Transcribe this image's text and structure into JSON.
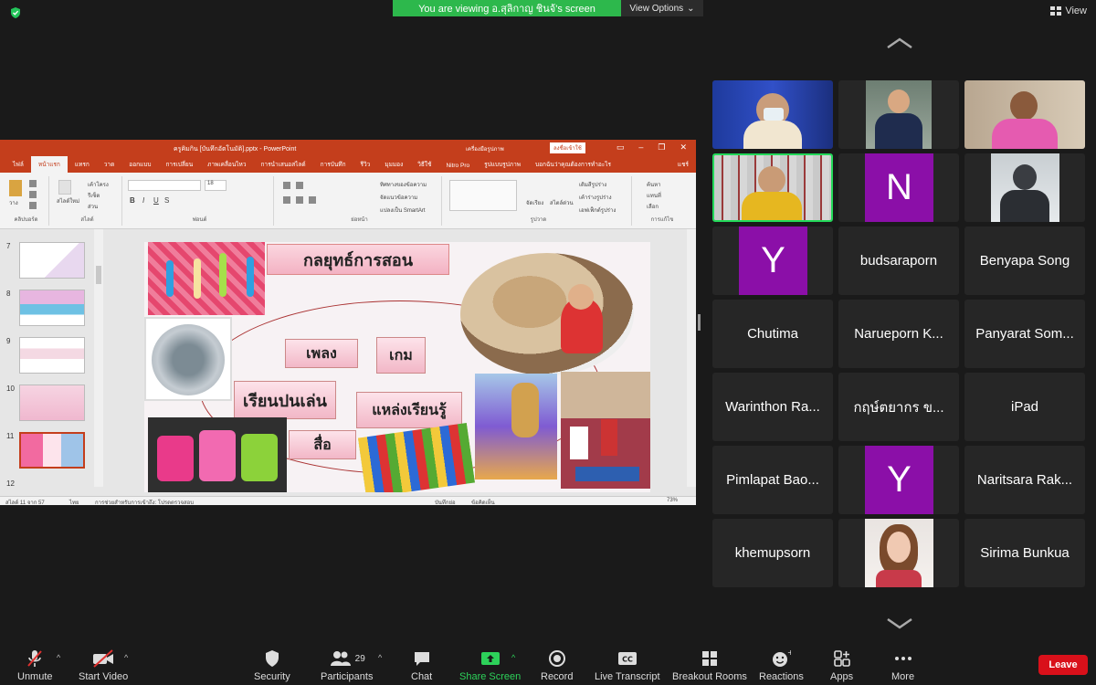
{
  "top": {
    "banner": "You are viewing อ.สุลิกาญ ชินจ้'s screen",
    "view_options": "View Options",
    "view": "View"
  },
  "ppt": {
    "title": "ครูคิมกิน [บันทึกอัตโนมัติ].pptx - PowerPoint",
    "context_tab": "เครื่องมือรูปภาพ",
    "signin": "ลงชื่อเข้าใช้",
    "tabs": [
      "ไฟล์",
      "หน้าแรก",
      "แทรก",
      "วาด",
      "ออกแบบ",
      "การเปลี่ยน",
      "ภาพเคลื่อนไหว",
      "การนำเสนอสไลด์",
      "การบันทึก",
      "รีวิว",
      "มุมมอง",
      "วิธีใช้",
      "Nitro Pro",
      "รูปแบบรูปภาพ",
      "บอกฉันว่าคุณต้องการทำอะไร",
      "แชร์"
    ],
    "groups": [
      "คลิปบอร์ด",
      "สไลด์",
      "ฟอนต์",
      "ย่อหน้า",
      "รูปวาด",
      "การแก้ไข"
    ],
    "ribbon_text": {
      "paste": "วาง",
      "new_slide": "สไลด์ใหม่",
      "layout": "เค้าโครง",
      "reset": "รีเซ็ต",
      "section": "ส่วน",
      "text_dir": "ทิศทางของข้อความ",
      "align_text": "จัดแนวข้อความ",
      "smartart": "แปลงเป็น SmartArt",
      "arrange": "จัดเรียง",
      "quick_styles": "สไตล์ด่วน",
      "fill": "เติมสีรูปร่าง",
      "outline": "เค้าร่างรูปร่าง",
      "effects": "เอฟเฟ็กต์รูปร่าง",
      "find": "ค้นหา",
      "replace": "แทนที่",
      "select": "เลือก",
      "font_size": "18"
    },
    "thumb_numbers": [
      "7",
      "8",
      "9",
      "10",
      "11",
      "12"
    ],
    "slide": {
      "title": "กลยุทธ์การสอน",
      "words": [
        "เพลง",
        "เกม",
        "เรียนปนเล่น",
        "แหล่งเรียนรู้",
        "สื่อ"
      ]
    },
    "status": {
      "slide_of": "สไลด์ 11 จาก 57",
      "lang": "ไทย",
      "accessibility": "การช่วยสำหรับการเข้าถึง: โปรดตรวจสอบ",
      "notes": "บันทึกย่อ",
      "comments": "ข้อคิดเห็น",
      "zoom": "73%"
    }
  },
  "gallery": {
    "tiles": [
      {
        "name": "",
        "avatar": ""
      },
      {
        "name": "",
        "avatar": ""
      },
      {
        "name": "",
        "avatar": ""
      },
      {
        "name": "",
        "avatar": ""
      },
      {
        "name": "",
        "avatar": "N"
      },
      {
        "name": "",
        "avatar": ""
      },
      {
        "name": "",
        "avatar": "Y"
      },
      {
        "name": "budsaraporn",
        "avatar": ""
      },
      {
        "name": "Benyapa Song",
        "avatar": ""
      },
      {
        "name": "Chutima",
        "avatar": ""
      },
      {
        "name": "Narueporn K...",
        "avatar": ""
      },
      {
        "name": "Panyarat Som...",
        "avatar": ""
      },
      {
        "name": "Warinthon Ra...",
        "avatar": ""
      },
      {
        "name": "กฤษ์ตยากร ข...",
        "avatar": ""
      },
      {
        "name": "iPad",
        "avatar": ""
      },
      {
        "name": "Pimlapat Bao...",
        "avatar": ""
      },
      {
        "name": "",
        "avatar": "Y"
      },
      {
        "name": "Naritsara Rak...",
        "avatar": ""
      },
      {
        "name": "khemupsorn",
        "avatar": ""
      },
      {
        "name": "",
        "avatar": ""
      },
      {
        "name": "Sirima Bunkua",
        "avatar": ""
      }
    ]
  },
  "toolbar": {
    "unmute": "Unmute",
    "start_video": "Start Video",
    "security": "Security",
    "participants": "Participants",
    "participants_count": "29",
    "chat": "Chat",
    "share_screen": "Share Screen",
    "record": "Record",
    "live_transcript": "Live Transcript",
    "breakout_rooms": "Breakout Rooms",
    "reactions": "Reactions",
    "apps": "Apps",
    "more": "More",
    "leave": "Leave"
  },
  "colors": {
    "zoom_green": "#2db84c",
    "active_border": "#23d959",
    "leave_red": "#d9101a",
    "ppt_orange": "#c43e1c",
    "avatar_purple": "#8b0fa8"
  }
}
